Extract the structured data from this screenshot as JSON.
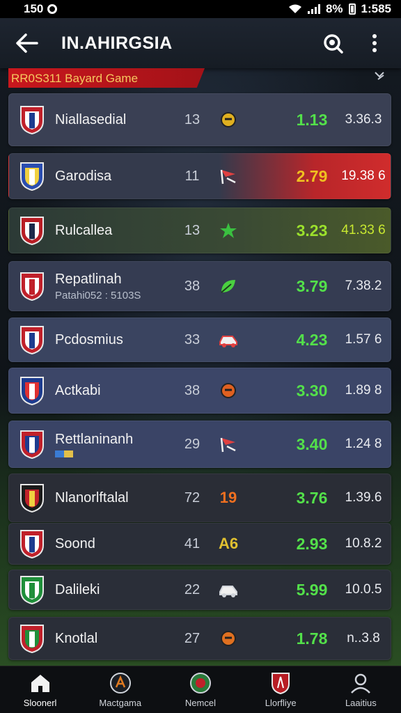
{
  "status_bar": {
    "left_time": "150",
    "battery_pct": "8%",
    "clock": "1:585"
  },
  "app_bar": {
    "title": "IN.AHIRGSIA"
  },
  "section": {
    "banner": "RR0S311 Bayard Game"
  },
  "rows": [
    {
      "name": "Niallasedial",
      "sub": "",
      "played": "13",
      "odds": "1.13",
      "odds_color": "#53e04a",
      "total": "3.36.3",
      "total_color": "#e8eaef",
      "crest": [
        "#c0202a",
        "#ffffff",
        "#1d3c8f"
      ],
      "form": "ball",
      "form_color": "#e0b020",
      "bg": "#3a4054"
    },
    {
      "name": "Garodisa",
      "sub": "",
      "played": "11",
      "odds": "2.79",
      "odds_color": "#f0c020",
      "total": "19.38 6",
      "total_color": "#ffffff",
      "crest": [
        "#2a4db0",
        "#f0d040",
        "#ffffff"
      ],
      "form": "flag",
      "form_color": "#e04040",
      "bg": "highlight-red"
    },
    {
      "name": "Rulcallea",
      "sub": "",
      "played": "13",
      "odds": "3.23",
      "odds_color": "#9be02c",
      "total": "41.33 6",
      "total_color": "#c8e830",
      "crest": [
        "#b81d24",
        "#ffffff",
        "#1c2a4a"
      ],
      "form": "star",
      "form_color": "#3ac040",
      "bg": "highlight-green"
    },
    {
      "name": "Repatlinah",
      "sub": "Patahi052 : 5103S",
      "played": "38",
      "odds": "3.79",
      "odds_color": "#53e04a",
      "total": "7.38.2",
      "total_color": "#e8eaef",
      "crest": [
        "#c0202a",
        "#ffffff",
        "#c0202a"
      ],
      "form": "leaf",
      "form_color": "#4ad040",
      "bg": "#353c52"
    },
    {
      "name": "Pcdosmius",
      "sub": "",
      "played": "33",
      "odds": "4.23",
      "odds_color": "#53e04a",
      "total": "1.57 6",
      "total_color": "#e8eaef",
      "crest": [
        "#c0202a",
        "#ffffff",
        "#1d3c8f"
      ],
      "form": "car",
      "form_color": "#e04040",
      "bg": "#3a4460"
    },
    {
      "name": "Actkabi",
      "sub": "",
      "played": "38",
      "odds": "3.30",
      "odds_color": "#53e04a",
      "total": "1.89 8",
      "total_color": "#e8eaef",
      "crest": [
        "#1d3c8f",
        "#e03030",
        "#ffffff"
      ],
      "form": "ball",
      "form_color": "#e06020",
      "bg": "#3c4668"
    },
    {
      "name": "Rettlaninanh",
      "sub": "",
      "played": "29",
      "odds": "3.40",
      "odds_color": "#53e04a",
      "total": "1.24 8",
      "total_color": "#e8eaef",
      "crest": [
        "#c0202a",
        "#1d3c8f",
        "#ffffff"
      ],
      "form": "flag",
      "form_color": "#e04040",
      "bg": "#3a4466"
    },
    {
      "name": "Nlanorlftalal",
      "sub": "",
      "played": "72",
      "odds": "3.76",
      "odds_color": "#53e04a",
      "total": "1.39.6",
      "total_color": "#e8eaef",
      "crest": [
        "#1a1a1a",
        "#c0202a",
        "#f0d040"
      ],
      "form": "19",
      "form_color": "#f07020",
      "bg": "#2a2d36"
    },
    {
      "name": "Soond",
      "sub": "",
      "played": "41",
      "odds": "2.93",
      "odds_color": "#53e04a",
      "total": "10.8.2",
      "total_color": "#e8eaef",
      "crest": [
        "#c0202a",
        "#ffffff",
        "#1d3c8f"
      ],
      "form": "A6",
      "form_color": "#e0c030",
      "bg": "#2a2e38"
    },
    {
      "name": "Dalileki",
      "sub": "",
      "played": "22",
      "odds": "5.99",
      "odds_color": "#53e04a",
      "total": "10.0.5",
      "total_color": "#e8eaef",
      "crest": [
        "#1f8f3a",
        "#ffffff",
        "#1f8f3a"
      ],
      "form": "car",
      "form_color": "#d0d4da",
      "bg": "#2a2e38"
    },
    {
      "name": "Knotlal",
      "sub": "",
      "played": "27",
      "odds": "1.78",
      "odds_color": "#53e04a",
      "total": "n..3.8",
      "total_color": "#e8eaef",
      "crest": [
        "#c0202a",
        "#1f8f3a",
        "#ffffff"
      ],
      "form": "ball",
      "form_color": "#e07020",
      "bg": "#2a2e38"
    }
  ],
  "bottom_nav": [
    {
      "label": "Sloonerl",
      "icon": "home-icon"
    },
    {
      "label": "Mactgama",
      "icon": "team-icon"
    },
    {
      "label": "Nemcel",
      "icon": "league-icon"
    },
    {
      "label": "Llorfliye",
      "icon": "shield-icon"
    },
    {
      "label": "Laaitius",
      "icon": "profile-icon"
    }
  ]
}
